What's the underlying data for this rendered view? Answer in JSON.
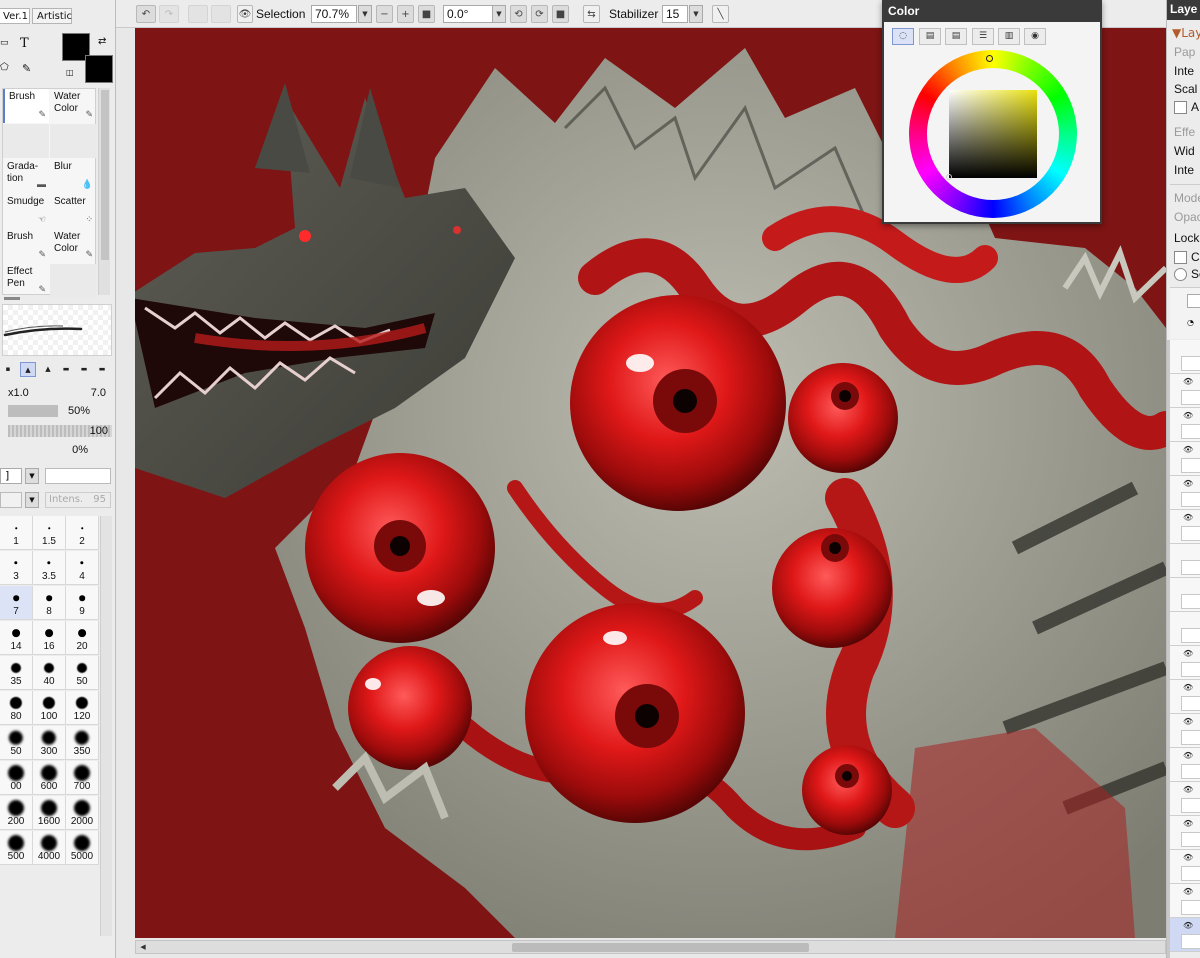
{
  "toolbar": {
    "selection_label": "Selection",
    "zoom_value": "70.7%",
    "rotation_value": "0.0°",
    "stabilizer_label": "Stabilizer",
    "stabilizer_value": "15"
  },
  "left_panel": {
    "tabs": [
      "Ver.1",
      "Artistic"
    ],
    "tools": [
      {
        "label": "Brush"
      },
      {
        "label": "Water Color"
      },
      {
        "label": ""
      },
      {
        "label": ""
      },
      {
        "label": "Grada-tion"
      },
      {
        "label": "Blur"
      },
      {
        "label": "Smudge"
      },
      {
        "label": "Scatter"
      },
      {
        "label": "Brush"
      },
      {
        "label": "Water Color"
      },
      {
        "label": "Effect Pen"
      },
      {
        "label": ""
      }
    ],
    "size_multiplier": "x1.0",
    "size_value": "7.0",
    "min_size_value": "50%",
    "density_value": "100",
    "blending_value": "0%",
    "intensity_label": "Intens.",
    "intensity_value": "95",
    "bracket_text": "]",
    "sizes": [
      "1",
      "1.5",
      "2",
      "3",
      "3.5",
      "4",
      "7",
      "8",
      "9",
      "14",
      "16",
      "20",
      "35",
      "40",
      "50",
      "80",
      "100",
      "120",
      "50",
      "300",
      "350",
      "00",
      "600",
      "700",
      "200",
      "1600",
      "2000",
      "500",
      "4000",
      "5000"
    ]
  },
  "color_panel": {
    "title": "Color",
    "tabs": [
      "wheel",
      "rgb",
      "hsv",
      "gray",
      "mix",
      "swatch"
    ],
    "square_hue_color": "#e9e10f"
  },
  "layer_panel": {
    "title": "Laye",
    "section_header": "Lay",
    "paper_label": "Pap",
    "inte_label": "Inte",
    "scale_label": "Scal",
    "a_label": "A",
    "effect_label": "Effe",
    "width_label": "Wid",
    "inte2_label": "Inte",
    "mode_label": "Mode",
    "opacity_label": "Opac",
    "lock_label": "Lock",
    "clip_label": "Cl",
    "sel_label": "Se"
  },
  "colors": {
    "canvas_background": "#7e1414",
    "accent_blue": "#5b7fc7",
    "panel_title": "#3a3a3a"
  }
}
